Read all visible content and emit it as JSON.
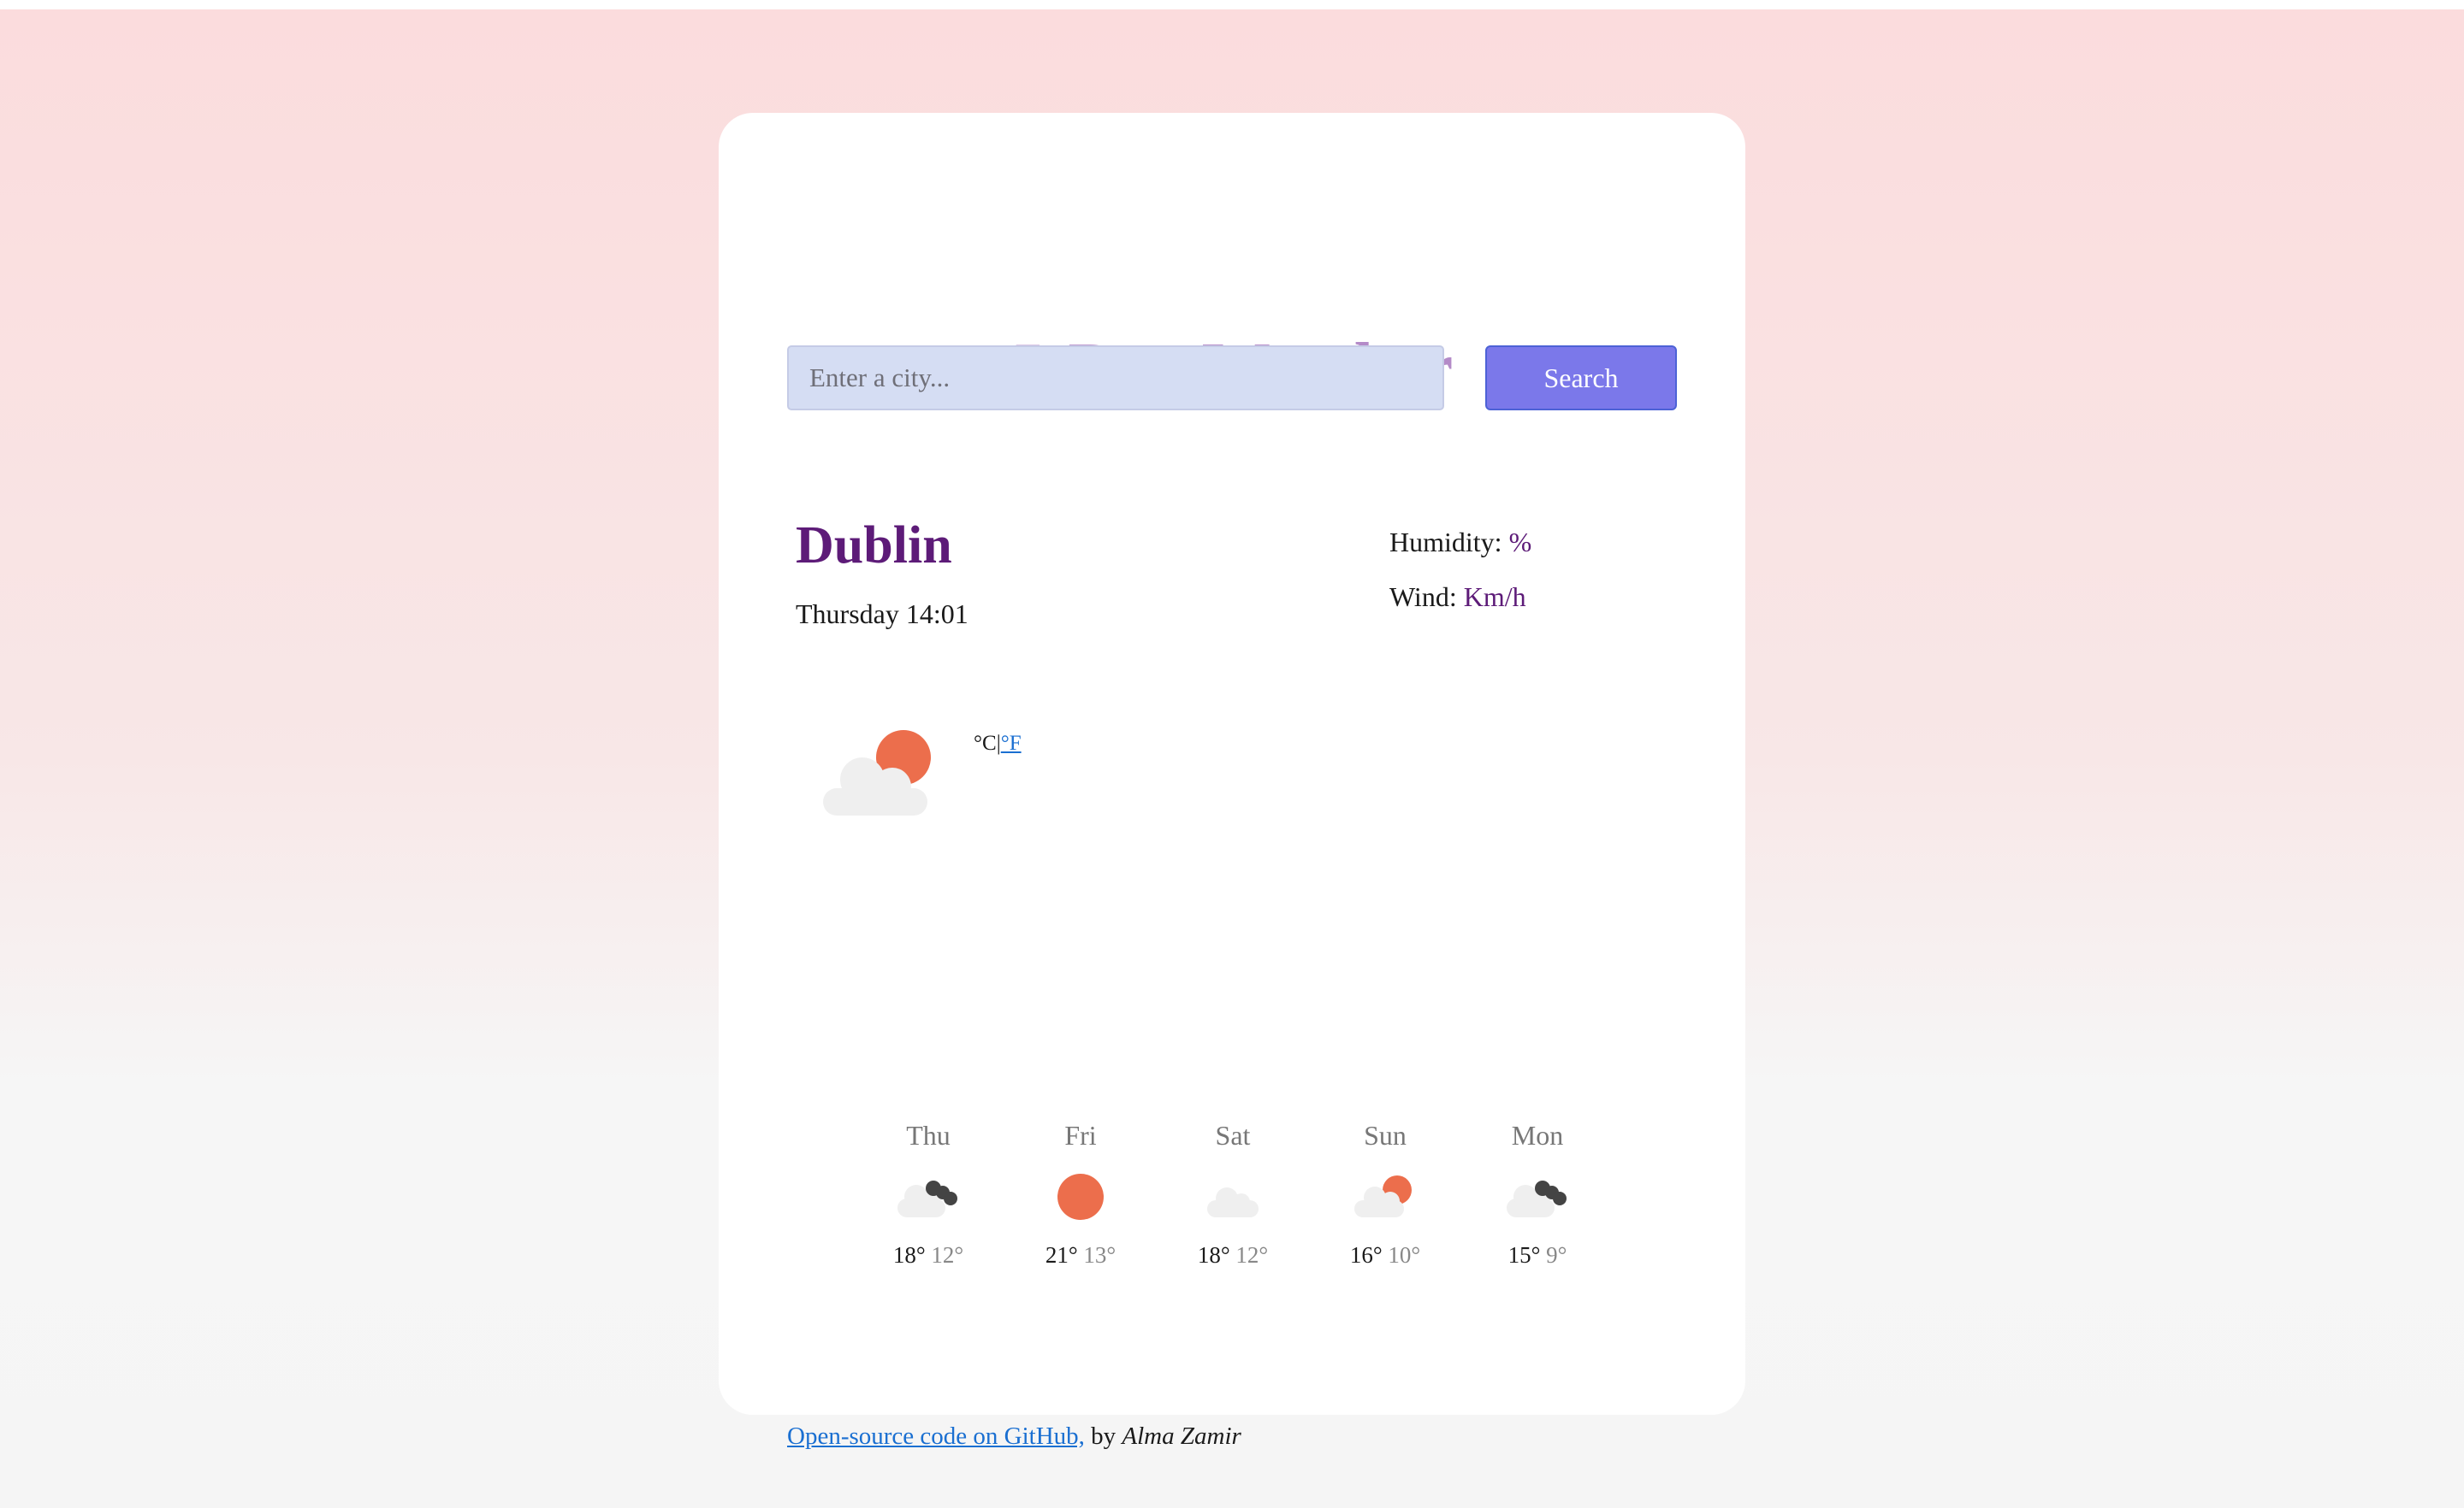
{
  "app": {
    "title": "5-Day Weather"
  },
  "search": {
    "placeholder": "Enter a city...",
    "value": "",
    "button_label": "Search"
  },
  "current": {
    "city": "Dublin",
    "datetime": "Thursday 14:01",
    "humidity_label": "Humidity:",
    "humidity_value": "%",
    "wind_label": "Wind:",
    "wind_value": "Km/h",
    "icon": "partly-cloudy-day-icon",
    "units": {
      "celsius": "°C",
      "separator": "|",
      "fahrenheit": "°F"
    }
  },
  "forecast": [
    {
      "day": "Thu",
      "max": "18°",
      "min": "12°",
      "icon": "partly-cloudy-night-icon"
    },
    {
      "day": "Fri",
      "max": "21°",
      "min": "13°",
      "icon": "sun-icon"
    },
    {
      "day": "Sat",
      "max": "18°",
      "min": "12°",
      "icon": "cloud-icon"
    },
    {
      "day": "Sun",
      "max": "16°",
      "min": "10°",
      "icon": "partly-cloudy-day-icon"
    },
    {
      "day": "Mon",
      "max": "15°",
      "min": "9°",
      "icon": "partly-cloudy-night-icon"
    }
  ],
  "footer": {
    "link_text": "Open-source code on GitHub,",
    "by_text": "by",
    "author": "Alma Zamir"
  },
  "colors": {
    "title": "#b48bc8",
    "accent": "#5d1b78",
    "button": "#7b78ea",
    "sun": "#ec6e4c",
    "cloud": "#f0f0f0",
    "moon": "#444444"
  }
}
